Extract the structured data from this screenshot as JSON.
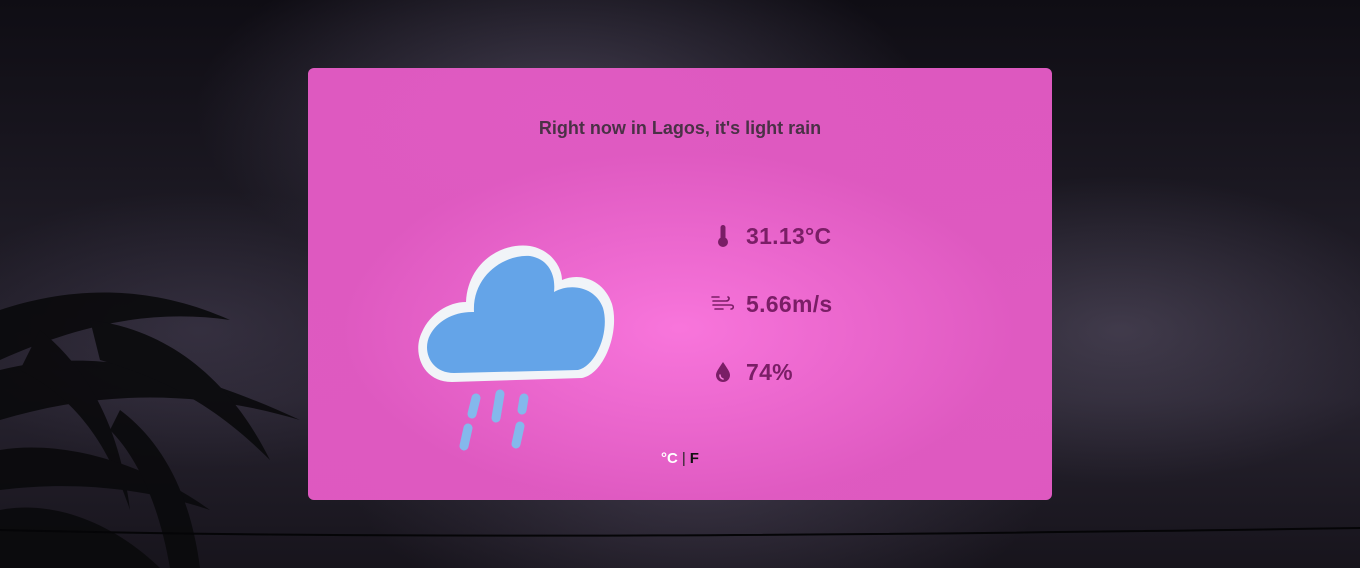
{
  "background": {
    "description_icon": "night-storm-sky-with-palm"
  },
  "card": {
    "title": "Right now in Lagos, it's light rain",
    "accent_color": "#e85cc8",
    "weather_icon": "rain-cloud-icon"
  },
  "stats": {
    "temperature": {
      "icon": "thermometer-icon",
      "value": "31.13°C"
    },
    "wind": {
      "icon": "wind-icon",
      "value": "5.66m/s"
    },
    "humidity": {
      "icon": "droplet-icon",
      "value": "74%"
    }
  },
  "units": {
    "celsius_label": "°C",
    "separator": "|",
    "fahrenheit_label": "F"
  }
}
